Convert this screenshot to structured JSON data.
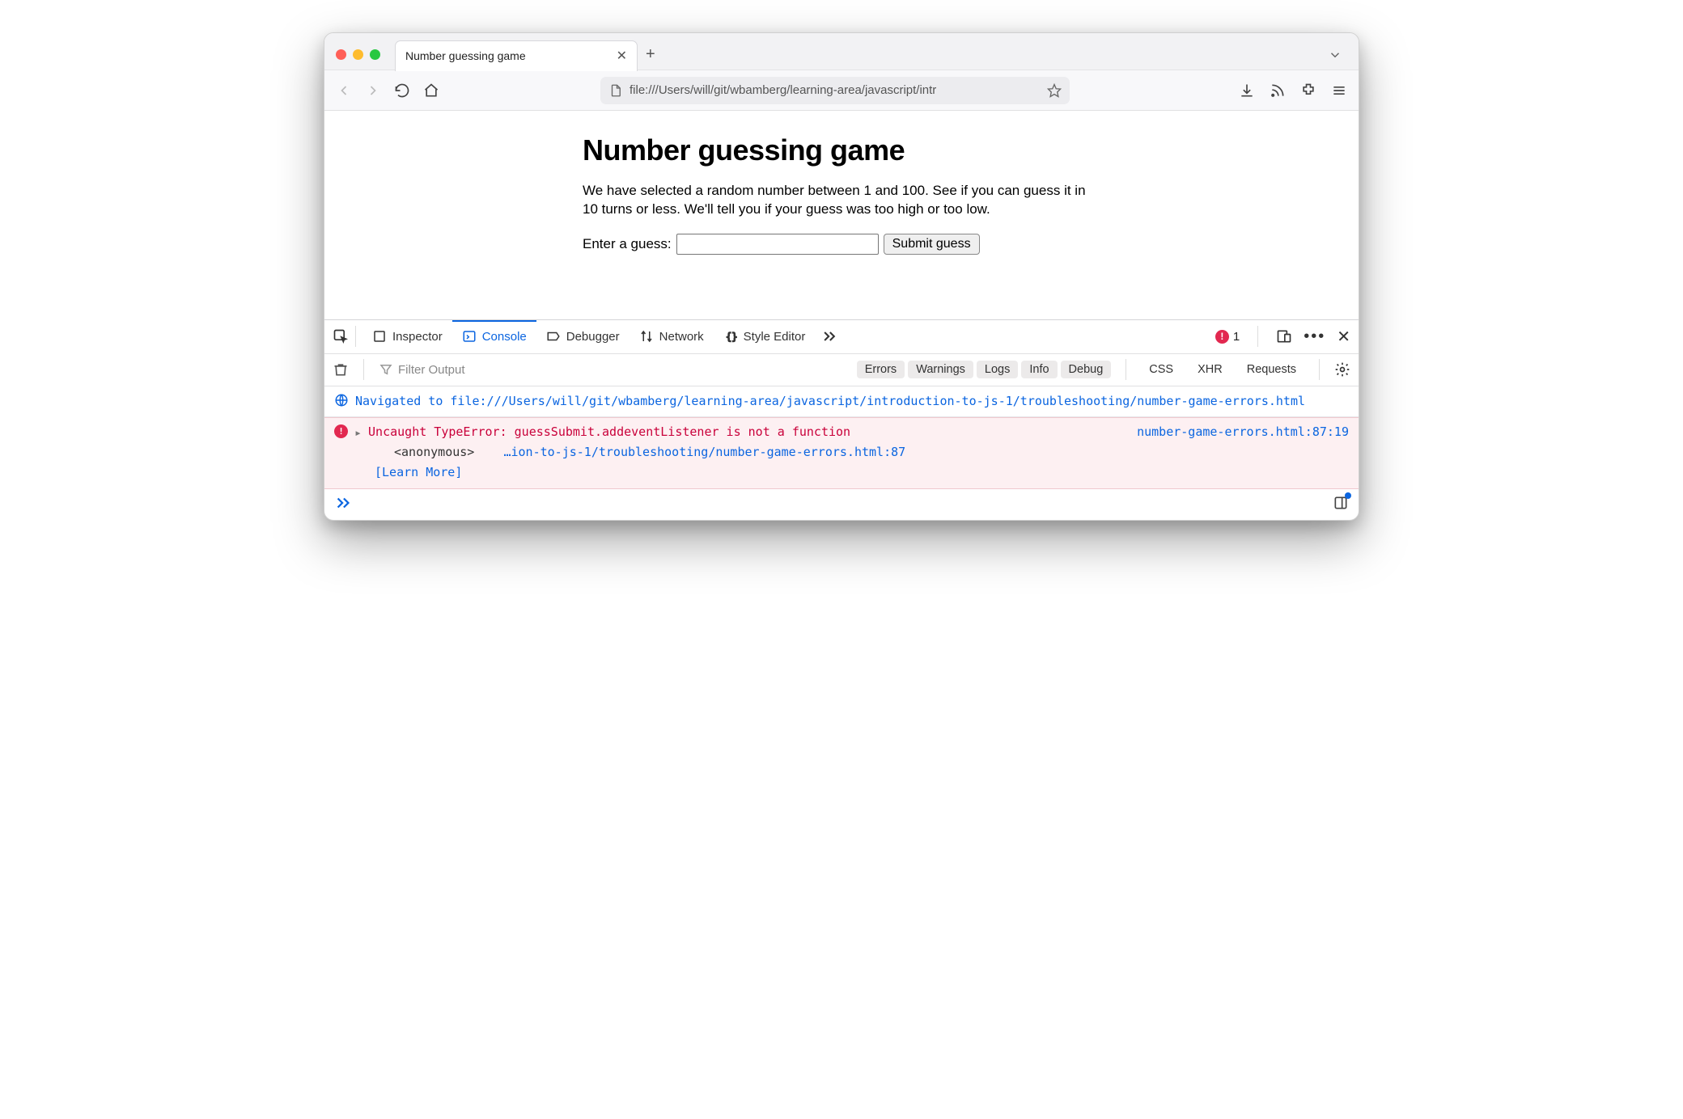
{
  "browser": {
    "tab_title": "Number guessing game",
    "url": "file:///Users/will/git/wbamberg/learning-area/javascript/intr"
  },
  "page": {
    "heading": "Number guessing game",
    "intro": "We have selected a random number between 1 and 100. See if you can guess it in 10 turns or less. We'll tell you if your guess was too high or too low.",
    "label": "Enter a guess:",
    "button": "Submit guess"
  },
  "devtools": {
    "tabs": {
      "inspector": "Inspector",
      "console": "Console",
      "debugger": "Debugger",
      "network": "Network",
      "styleeditor": "Style Editor"
    },
    "error_count": "1",
    "filter_placeholder": "Filter Output",
    "chips": {
      "errors": "Errors",
      "warnings": "Warnings",
      "logs": "Logs",
      "info": "Info",
      "debug": "Debug",
      "css": "CSS",
      "xhr": "XHR",
      "requests": "Requests"
    },
    "nav_prefix": "Navigated to ",
    "nav_url": "file:///Users/will/git/wbamberg/learning-area/javascript/introduction-to-js-1/troubleshooting/number-game-errors.html",
    "error_message": "Uncaught TypeError: guessSubmit.addeventListener is not a function",
    "error_source": "number-game-errors.html:87:19",
    "stack_anon": "<anonymous>",
    "stack_loc": "…ion-to-js-1/troubleshooting/number-game-errors.html:87",
    "learn_more": "[Learn More]"
  }
}
